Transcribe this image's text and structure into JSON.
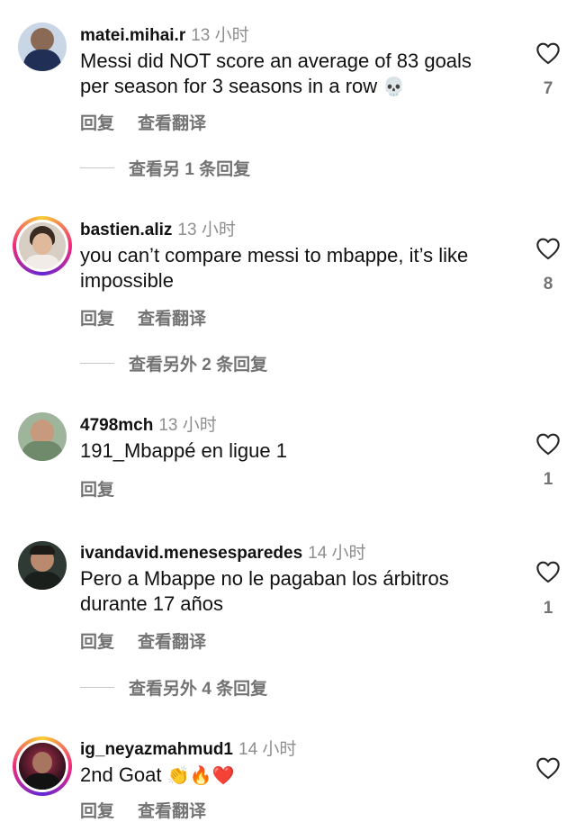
{
  "comments": [
    {
      "username": "matei.mihai.r",
      "time": "13 小时",
      "text": "Messi did NOT score an average of 83 goals per season for 3 seasons in a row",
      "emoji": "💀",
      "reply_label": "回复",
      "translate_label": "查看翻译",
      "view_replies": "查看另 1 条回复",
      "likes": "7"
    },
    {
      "username": "bastien.aliz",
      "time": "13 小时",
      "text": "you can’t compare messi to mbappe, it’s like impossible",
      "emoji": "",
      "reply_label": "回复",
      "translate_label": "查看翻译",
      "view_replies": "查看另外 2 条回复",
      "likes": "8"
    },
    {
      "username": "4798mch",
      "time": "13 小时",
      "text": "191_Mbappé en ligue 1",
      "emoji": "",
      "reply_label": "回复",
      "translate_label": "",
      "view_replies": "",
      "likes": "1"
    },
    {
      "username": "ivandavid.menesesparedes",
      "time": "14 小时",
      "text": "Pero a Mbappe no le pagaban los árbitros durante 17 años",
      "emoji": "",
      "reply_label": "回复",
      "translate_label": "查看翻译",
      "view_replies": "查看另外 4 条回复",
      "likes": "1"
    },
    {
      "username": "ig_neyazmahmud1",
      "time": "14 小时",
      "text": "2nd Goat",
      "emoji": "👏🔥❤️",
      "reply_label": "回复",
      "translate_label": "查看翻译",
      "view_replies": "",
      "likes": ""
    }
  ],
  "icons": {
    "like": "heart-outline-icon"
  },
  "colors": {
    "secondary_text": "#737373",
    "story_ring": "#ee2a7b"
  }
}
